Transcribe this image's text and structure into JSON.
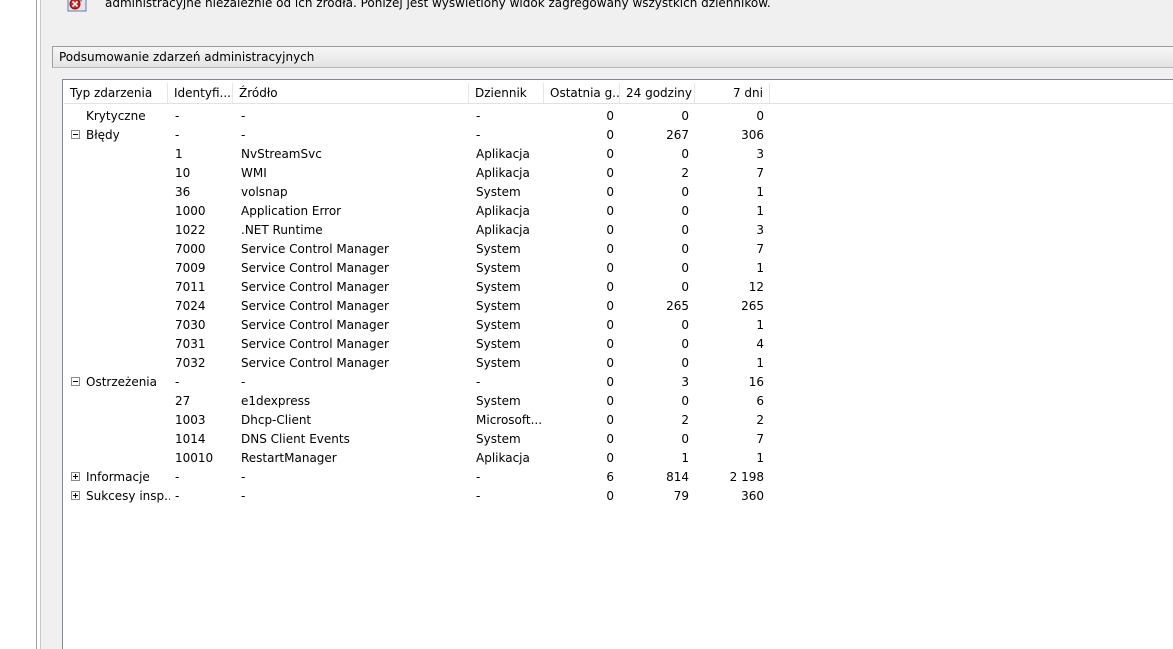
{
  "banner": {
    "text": "administracyjne niezależnie od ich źródła. Poniżej jest wyświetlony widok zagregowany wszystkich dzienników.",
    "icon": "event-log-error-icon"
  },
  "section": {
    "title": "Podsumowanie zdarzeń administracyjnych"
  },
  "columns": [
    "Typ zdarzenia",
    "Identyfi...",
    "Źródło",
    "Dziennik",
    "Ostatnia g...",
    "24 godziny",
    "7 dni"
  ],
  "rows": [
    {
      "type": "Krytyczne",
      "id": "-",
      "source": "-",
      "log": "-",
      "hour": "0",
      "day": "0",
      "week": "0",
      "level": 0,
      "toggle": ""
    },
    {
      "type": "Błędy",
      "id": "-",
      "source": "-",
      "log": "-",
      "hour": "0",
      "day": "267",
      "week": "306",
      "level": 0,
      "toggle": "minus"
    },
    {
      "type": "",
      "id": "1",
      "source": "NvStreamSvc",
      "log": "Aplikacja",
      "hour": "0",
      "day": "0",
      "week": "3",
      "level": 1,
      "toggle": ""
    },
    {
      "type": "",
      "id": "10",
      "source": "WMI",
      "log": "Aplikacja",
      "hour": "0",
      "day": "2",
      "week": "7",
      "level": 1,
      "toggle": ""
    },
    {
      "type": "",
      "id": "36",
      "source": "volsnap",
      "log": "System",
      "hour": "0",
      "day": "0",
      "week": "1",
      "level": 1,
      "toggle": ""
    },
    {
      "type": "",
      "id": "1000",
      "source": "Application Error",
      "log": "Aplikacja",
      "hour": "0",
      "day": "0",
      "week": "1",
      "level": 1,
      "toggle": ""
    },
    {
      "type": "",
      "id": "1022",
      "source": ".NET Runtime",
      "log": "Aplikacja",
      "hour": "0",
      "day": "0",
      "week": "3",
      "level": 1,
      "toggle": ""
    },
    {
      "type": "",
      "id": "7000",
      "source": "Service Control Manager",
      "log": "System",
      "hour": "0",
      "day": "0",
      "week": "7",
      "level": 1,
      "toggle": ""
    },
    {
      "type": "",
      "id": "7009",
      "source": "Service Control Manager",
      "log": "System",
      "hour": "0",
      "day": "0",
      "week": "1",
      "level": 1,
      "toggle": ""
    },
    {
      "type": "",
      "id": "7011",
      "source": "Service Control Manager",
      "log": "System",
      "hour": "0",
      "day": "0",
      "week": "12",
      "level": 1,
      "toggle": ""
    },
    {
      "type": "",
      "id": "7024",
      "source": "Service Control Manager",
      "log": "System",
      "hour": "0",
      "day": "265",
      "week": "265",
      "level": 1,
      "toggle": ""
    },
    {
      "type": "",
      "id": "7030",
      "source": "Service Control Manager",
      "log": "System",
      "hour": "0",
      "day": "0",
      "week": "1",
      "level": 1,
      "toggle": ""
    },
    {
      "type": "",
      "id": "7031",
      "source": "Service Control Manager",
      "log": "System",
      "hour": "0",
      "day": "0",
      "week": "4",
      "level": 1,
      "toggle": ""
    },
    {
      "type": "",
      "id": "7032",
      "source": "Service Control Manager",
      "log": "System",
      "hour": "0",
      "day": "0",
      "week": "1",
      "level": 1,
      "toggle": ""
    },
    {
      "type": "Ostrzeżenia",
      "id": "-",
      "source": "-",
      "log": "-",
      "hour": "0",
      "day": "3",
      "week": "16",
      "level": 0,
      "toggle": "minus"
    },
    {
      "type": "",
      "id": "27",
      "source": "e1dexpress",
      "log": "System",
      "hour": "0",
      "day": "0",
      "week": "6",
      "level": 1,
      "toggle": ""
    },
    {
      "type": "",
      "id": "1003",
      "source": "Dhcp-Client",
      "log": "Microsoft...",
      "hour": "0",
      "day": "2",
      "week": "2",
      "level": 1,
      "toggle": ""
    },
    {
      "type": "",
      "id": "1014",
      "source": "DNS Client Events",
      "log": "System",
      "hour": "0",
      "day": "0",
      "week": "7",
      "level": 1,
      "toggle": ""
    },
    {
      "type": "",
      "id": "10010",
      "source": "RestartManager",
      "log": "Aplikacja",
      "hour": "0",
      "day": "1",
      "week": "1",
      "level": 1,
      "toggle": ""
    },
    {
      "type": "Informacje",
      "id": "-",
      "source": "-",
      "log": "-",
      "hour": "6",
      "day": "814",
      "week": "2 198",
      "level": 0,
      "toggle": "plus"
    },
    {
      "type": "Sukcesy insp...",
      "id": "-",
      "source": "-",
      "log": "-",
      "hour": "0",
      "day": "79",
      "week": "360",
      "level": 0,
      "toggle": "plus"
    }
  ]
}
